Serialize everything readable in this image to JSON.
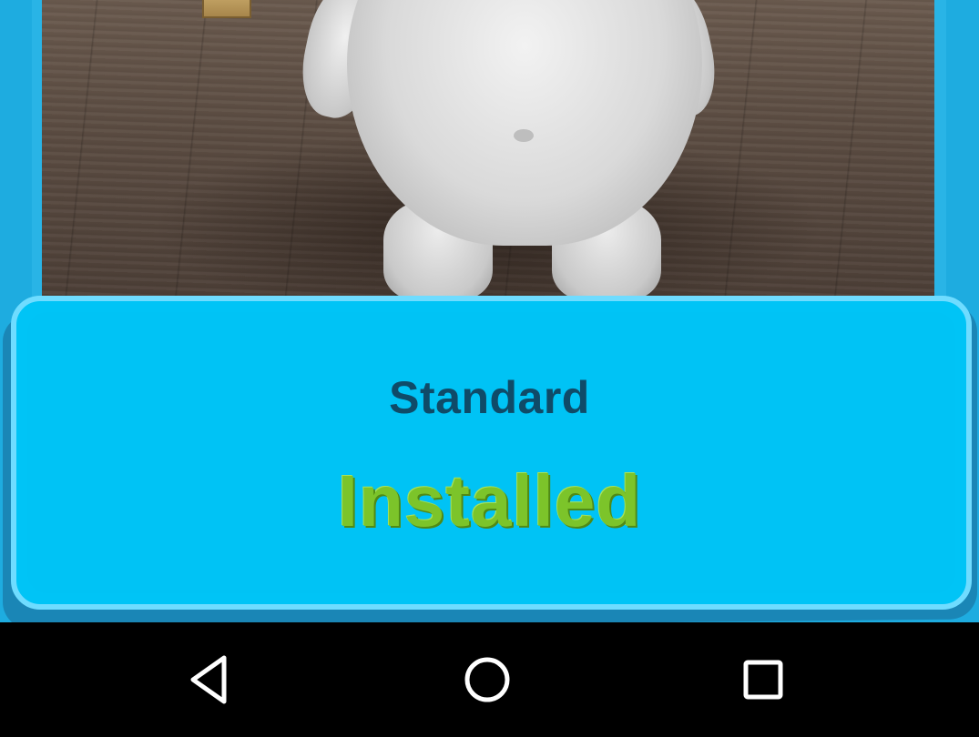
{
  "app": {
    "card": {
      "title": "Standard",
      "status": "Installed"
    },
    "colors": {
      "background": "#1eace0",
      "card": "#00c4f6",
      "title_text": "#0f4b68",
      "status_text": "#7cc42a"
    }
  },
  "navbar": {
    "back_icon": "triangle-back-icon",
    "home_icon": "circle-home-icon",
    "recent_icon": "square-recent-apps-icon"
  }
}
